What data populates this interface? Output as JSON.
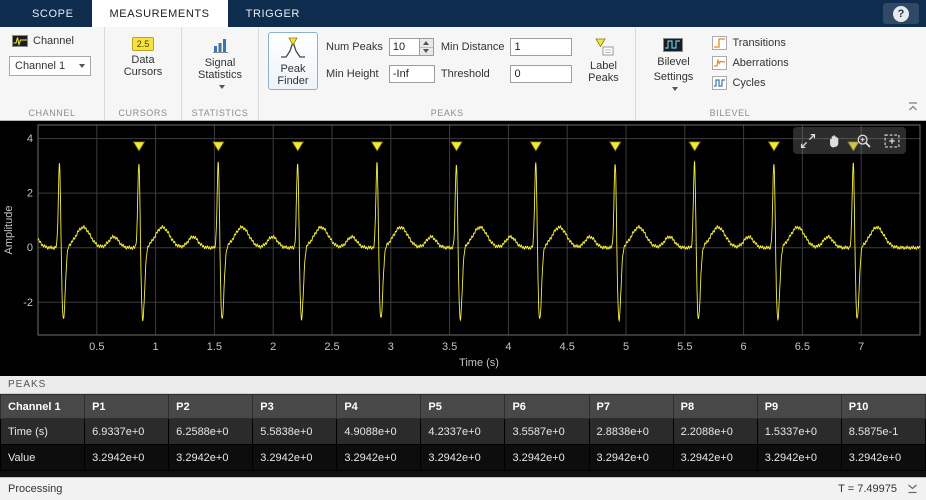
{
  "tabbar": {
    "tabs": [
      {
        "label": "SCOPE",
        "active": false
      },
      {
        "label": "MEASUREMENTS",
        "active": true
      },
      {
        "label": "TRIGGER",
        "active": false
      }
    ],
    "help": "?"
  },
  "toolstrip": {
    "channel": {
      "button_label": "Channel",
      "selector_value": "Channel 1",
      "section_label": "CHANNEL"
    },
    "cursors": {
      "button_label": "Data Cursors",
      "icon_text": "2.5",
      "section_label": "CURSORS"
    },
    "statistics": {
      "button_label": "Signal Statistics",
      "section_label": "STATISTICS"
    },
    "peaks": {
      "peak_finder_label": "Peak Finder",
      "num_peaks_label": "Num Peaks",
      "num_peaks_value": "10",
      "min_height_label": "Min Height",
      "min_height_value": "-Inf",
      "min_distance_label": "Min Distance",
      "min_distance_value": "1",
      "threshold_label": "Threshold",
      "threshold_value": "0",
      "label_peaks_label": "Label Peaks",
      "section_label": "PEAKS"
    },
    "bilevel": {
      "settings_line1": "Bilevel",
      "settings_line2": "Settings",
      "transitions_label": "Transitions",
      "aberrations_label": "Aberrations",
      "cycles_label": "Cycles",
      "section_label": "BILEVEL"
    }
  },
  "chart_data": {
    "type": "line",
    "title": "",
    "xlabel": "Time (s)",
    "ylabel": "Amplitude",
    "xlim": [
      0,
      7.5
    ],
    "ylim": [
      -3.2,
      4.5
    ],
    "xticks": [
      0.5,
      1,
      1.5,
      2,
      2.5,
      3,
      3.5,
      4,
      4.5,
      5,
      5.5,
      6,
      6.5,
      7
    ],
    "yticks": [
      -2,
      0,
      2,
      4
    ],
    "grid": true,
    "background": "#000000",
    "grid_color": "#3c3c3c",
    "axis_color": "#c4c4c4",
    "line_color": "#f5ef3d",
    "marker_color": "#f2e73a",
    "series": [
      {
        "name": "Channel 1",
        "kind": "synthetic-ecg",
        "beat_times": [
          0.18375,
          0.85875,
          1.5337,
          2.2088,
          2.8838,
          3.5587,
          4.2337,
          4.9088,
          5.5838,
          6.2588,
          6.9337
        ],
        "r_amplitude": 3.2942,
        "s_depth": -2.65,
        "p_amplitude": 0.4,
        "t_amplitude": 0.75
      }
    ],
    "peak_markers": {
      "times": [
        0.85875,
        1.5337,
        2.2088,
        2.8838,
        3.5587,
        4.2337,
        4.9088,
        5.5838,
        6.2588,
        6.9337
      ],
      "value": 3.2942,
      "marker_y": 3.55
    }
  },
  "peaks_table": {
    "panel_title": "PEAKS",
    "columns": [
      "Channel 1",
      "P1",
      "P2",
      "P3",
      "P4",
      "P5",
      "P6",
      "P7",
      "P8",
      "P9",
      "P10"
    ],
    "rows": [
      {
        "label": "Time (s)",
        "values": [
          "6.9337e+0",
          "6.2588e+0",
          "5.5838e+0",
          "4.9088e+0",
          "4.2337e+0",
          "3.5587e+0",
          "2.8838e+0",
          "2.2088e+0",
          "1.5337e+0",
          "8.5875e-1"
        ]
      },
      {
        "label": "Value",
        "values": [
          "3.2942e+0",
          "3.2942e+0",
          "3.2942e+0",
          "3.2942e+0",
          "3.2942e+0",
          "3.2942e+0",
          "3.2942e+0",
          "3.2942e+0",
          "3.2942e+0",
          "3.2942e+0"
        ]
      }
    ]
  },
  "statusbar": {
    "left": "Processing",
    "right": "T = 7.49975"
  },
  "colors": {
    "tabbar_bg": "#0d2c4e",
    "toolstrip_bg": "#f6f6f6",
    "plot_bg": "#000000",
    "signal_yellow": "#f5ef3d"
  }
}
